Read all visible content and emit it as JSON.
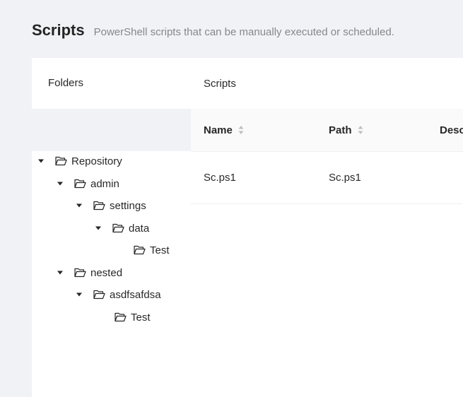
{
  "header": {
    "title": "Scripts",
    "subtitle": "PowerShell scripts that can be manually executed or scheduled."
  },
  "folders": {
    "title": "Folders",
    "tree": [
      {
        "label": "Repository",
        "expanded": true
      },
      {
        "label": "admin",
        "expanded": true
      },
      {
        "label": "settings",
        "expanded": true
      },
      {
        "label": "data",
        "expanded": true
      },
      {
        "label": "Test",
        "expanded": false
      },
      {
        "label": "nested",
        "expanded": true
      },
      {
        "label": "asdfsafdsa",
        "expanded": true
      },
      {
        "label": "Test",
        "expanded": false
      }
    ]
  },
  "scripts": {
    "title": "Scripts",
    "columns": [
      {
        "label": "Name"
      },
      {
        "label": "Path"
      },
      {
        "label": "Desc"
      }
    ],
    "rows": [
      {
        "name": "Sc.ps1",
        "path": "Sc.ps1",
        "description": ""
      }
    ]
  },
  "colors": {
    "background": "#f0f2f5",
    "card": "#ffffff",
    "table_header": "#fafafa",
    "sorter": "#bfbfbf"
  },
  "icons": {
    "expand": "caret-down-icon",
    "folder": "folder-open-icon",
    "sort": "sort-icon"
  }
}
